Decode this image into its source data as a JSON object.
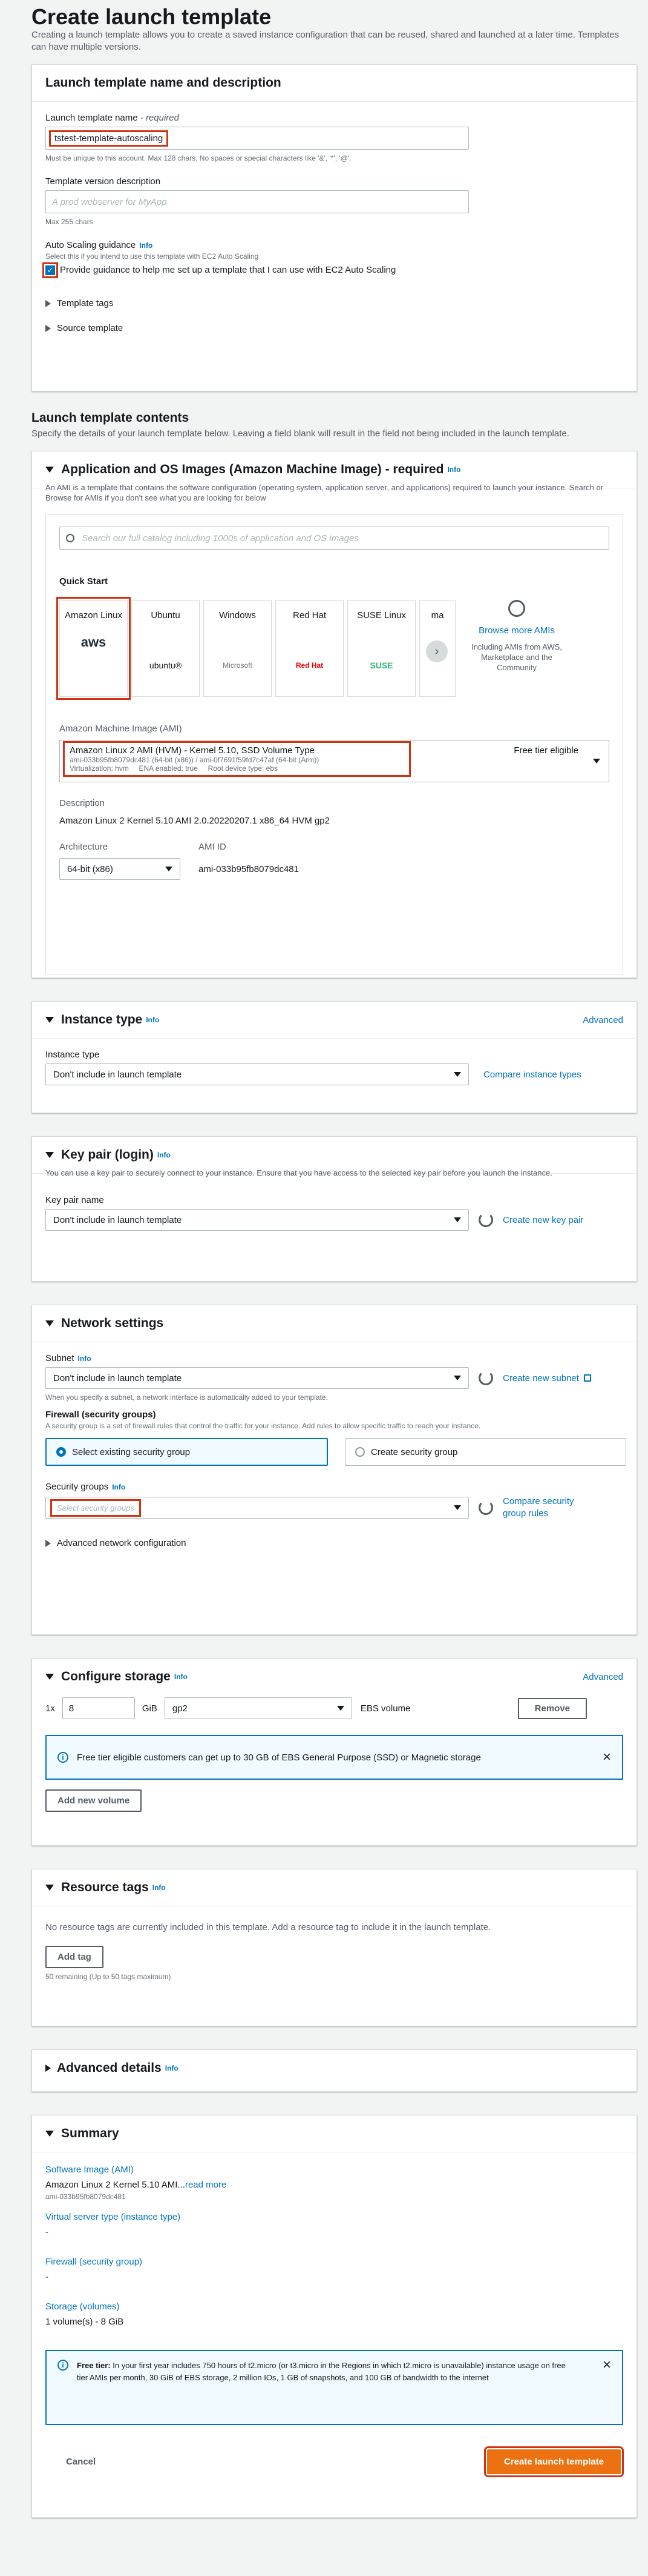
{
  "page": {
    "title": "Create launch template",
    "intro": "Creating a launch template allows you to create a saved instance configuration that can be reused, shared and launched at a later time. Templates can have multiple versions."
  },
  "name_section": {
    "title": "Launch template name and description",
    "name_label": "Launch template name",
    "name_req": " - required",
    "name_value": "tstest-template-autoscaling",
    "name_hint": "Must be unique to this account. Max 128 chars. No spaces or special characters like '&', '*', '@'.",
    "desc_label": "Template version description",
    "desc_placeholder": "A prod webserver for MyApp",
    "desc_hint": "Max 255 chars",
    "asg_label": "Auto Scaling guidance",
    "asg_info": "Info",
    "asg_hint": "Select this if you intend to use this template with EC2 Auto Scaling",
    "asg_check": "Provide guidance to help me set up a template that I can use with EC2 Auto Scaling",
    "tags": "Template tags",
    "source": "Source template"
  },
  "contents": {
    "title": "Launch template contents",
    "desc": "Specify the details of your launch template below. Leaving a field blank will result in the field not being included in the launch template."
  },
  "ami": {
    "title": "Application and OS Images (Amazon Machine Image) - required",
    "info": "Info",
    "desc": "An AMI is a template that contains the software configuration (operating system, application server, and applications) required to launch your instance. Search or Browse for AMIs if you don't see what you are looking for below",
    "search": "Search our full catalog including 1000s of application and OS images",
    "quick": "Quick Start",
    "tiles": [
      "Amazon Linux",
      "Ubuntu",
      "Windows",
      "Red Hat",
      "SUSE Linux",
      "ma"
    ],
    "tile_logos": [
      "aws",
      "ubuntu®",
      "Microsoft",
      "Red Hat",
      "SUSE",
      ""
    ],
    "browse": "Browse more AMIs",
    "browse_sub": "Including AMIs from AWS, Marketplace and the Community",
    "ami_label": "Amazon Machine Image (AMI)",
    "ami_name": "Amazon Linux 2 AMI (HVM) - Kernel 5.10, SSD Volume Type",
    "ami_ids": "ami-033b95fb8079dc481 (64-bit (x86)) / ami-0f7691f59fd7c47af (64-bit (Arm))",
    "ami_meta": "Virtualization: hvm     ENA enabled: true     Root device type: ebs",
    "free": "Free tier eligible",
    "desc_label": "Description",
    "desc_value": "Amazon Linux 2 Kernel 5.10 AMI 2.0.20220207.1 x86_64 HVM gp2",
    "arch_label": "Architecture",
    "arch_value": "64-bit (x86)",
    "amiid_label": "AMI ID",
    "amiid_value": "ami-033b95fb8079dc481"
  },
  "instance": {
    "title": "Instance type",
    "info": "Info",
    "adv": "Advanced",
    "label": "Instance type",
    "value": "Don't include in launch template",
    "compare": "Compare instance types"
  },
  "keypair": {
    "title": "Key pair (login)",
    "info": "Info",
    "desc": "You can use a key pair to securely connect to your instance. Ensure that you have access to the selected key pair before you launch the instance.",
    "label": "Key pair name",
    "value": "Don't include in launch template",
    "create": "Create new key pair"
  },
  "network": {
    "title": "Network settings",
    "subnet_label": "Subnet",
    "info": "Info",
    "subnet_value": "Don't include in launch template",
    "create_subnet": "Create new subnet",
    "subnet_hint": "When you specify a subnet, a network interface is automatically added to your template.",
    "fw_label": "Firewall (security groups)",
    "fw_hint": "A security group is a set of firewall rules that control the traffic for your instance. Add rules to allow specific traffic to reach your instance.",
    "opt1": "Select existing security group",
    "opt2": "Create security group",
    "sg_label": "Security groups",
    "sg_placeholder": "Select security groups",
    "compare": "Compare security group rules",
    "advanced": "Advanced network configuration"
  },
  "storage": {
    "title": "Configure storage",
    "info": "Info",
    "adv": "Advanced",
    "count": "1x",
    "size": "8",
    "unit": "GiB",
    "type": "gp2",
    "ebs": "EBS volume",
    "remove": "Remove",
    "free_msg": "Free tier eligible customers can get up to 30 GB of EBS General Purpose (SSD) or Magnetic storage",
    "add": "Add new volume"
  },
  "tags": {
    "title": "Resource tags",
    "info": "Info",
    "empty": "No resource tags are currently included in this template. Add a resource tag to include it in the launch template.",
    "add": "Add tag",
    "remaining": "50 remaining (Up to 50 tags maximum)"
  },
  "details": {
    "title": "Advanced details",
    "info": "Info"
  },
  "summary": {
    "title": "Summary",
    "ami_k": "Software Image (AMI)",
    "ami_v": "Amazon Linux 2 Kernel 5.10 AMI...",
    "read_more": "read more",
    "ami_id": "ami-033b95fb8079dc481",
    "vs_k": "Virtual server type (instance type)",
    "dash": "-",
    "fw_k": "Firewall (security group)",
    "st_k": "Storage (volumes)",
    "st_v": "1 volume(s) - 8 GiB",
    "free_b": "Free tier:",
    "free_t": " In your first year includes 750 hours of t2.micro (or t3.micro in the Regions in which t2.micro is unavailable) instance usage on free tier AMIs per month, 30 GiB of EBS storage, 2 million IOs, 1 GB of snapshots, and 100 GB of bandwidth to the internet",
    "cancel": "Cancel",
    "create": "Create launch template"
  },
  "colors": {
    "accent": "#ec7211",
    "link": "#0073bb",
    "highlight": "#d13212"
  }
}
